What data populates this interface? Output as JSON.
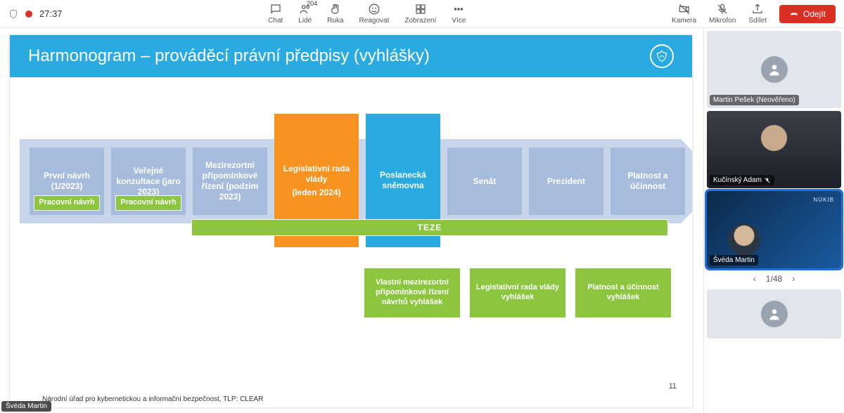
{
  "topbar": {
    "timer": "27:37",
    "buttons": {
      "chat": "Chat",
      "people": "Lidé",
      "people_count": "204",
      "hand": "Ruka",
      "react": "Reagovat",
      "view": "Zobrazení",
      "more": "Více",
      "camera": "Kamera",
      "mic": "Mikrofon",
      "share": "Sdílet"
    },
    "leave": "Odejít"
  },
  "slide": {
    "title": "Harmonogram – prováděcí právní předpisy (vyhlášky)",
    "boxes": [
      {
        "label": "První návrh (1/2023)",
        "sub": "Pracovní návrh"
      },
      {
        "label": "Veřejné konzultace (jaro 2023)",
        "sub": "Pracovní návrh"
      },
      {
        "label": "Mezirezortní připomínkové řízení (podzim 2023)"
      },
      {
        "label": "Legislativní rada vlády",
        "subline": "(leden 2024)"
      },
      {
        "label": "Poslanecká sněmovna"
      },
      {
        "label": "Senát"
      },
      {
        "label": "Prezident"
      },
      {
        "label": "Platnost a účinnost"
      }
    ],
    "teze": "TEZE",
    "bottom": [
      "Vlastní mezirezortní připomínkové řízení návrhů vyhlášek",
      "Legislativní rada vlády vyhlášek",
      "Platnost a účinnost vyhlášek"
    ],
    "page": "11",
    "footer": "Národní úřad pro kybernetickou a informační bezpečnost, TLP: CLEAR",
    "presenter": "Švéda Martin"
  },
  "participants": [
    {
      "name": "Martin Pešek (Neověřeno)"
    },
    {
      "name": "Kučínský Adam"
    },
    {
      "name": "Švéda Martin",
      "brand": "NÚKIB"
    }
  ],
  "pager": {
    "current": "1",
    "total": "48"
  }
}
